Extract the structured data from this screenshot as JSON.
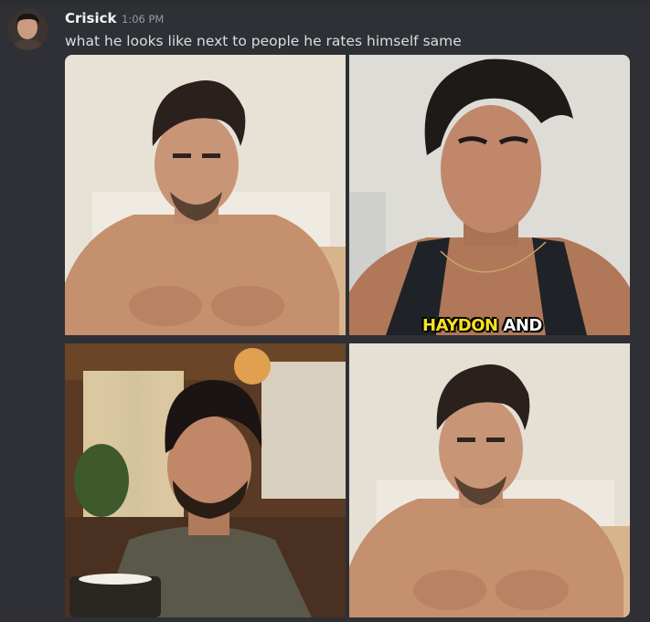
{
  "message": {
    "username": "Crisick",
    "timestamp": "1:06 PM",
    "content": "what he looks like next to people he rates himself same"
  },
  "attachments": [
    {
      "caption_highlight": "HAYDON",
      "caption_rest": " AND"
    }
  ],
  "colors": {
    "background": "#313338",
    "username": "#f2f3f5",
    "text": "#dbdee1",
    "timestamp": "#949ba4",
    "caption_highlight": "#f5e11f"
  }
}
